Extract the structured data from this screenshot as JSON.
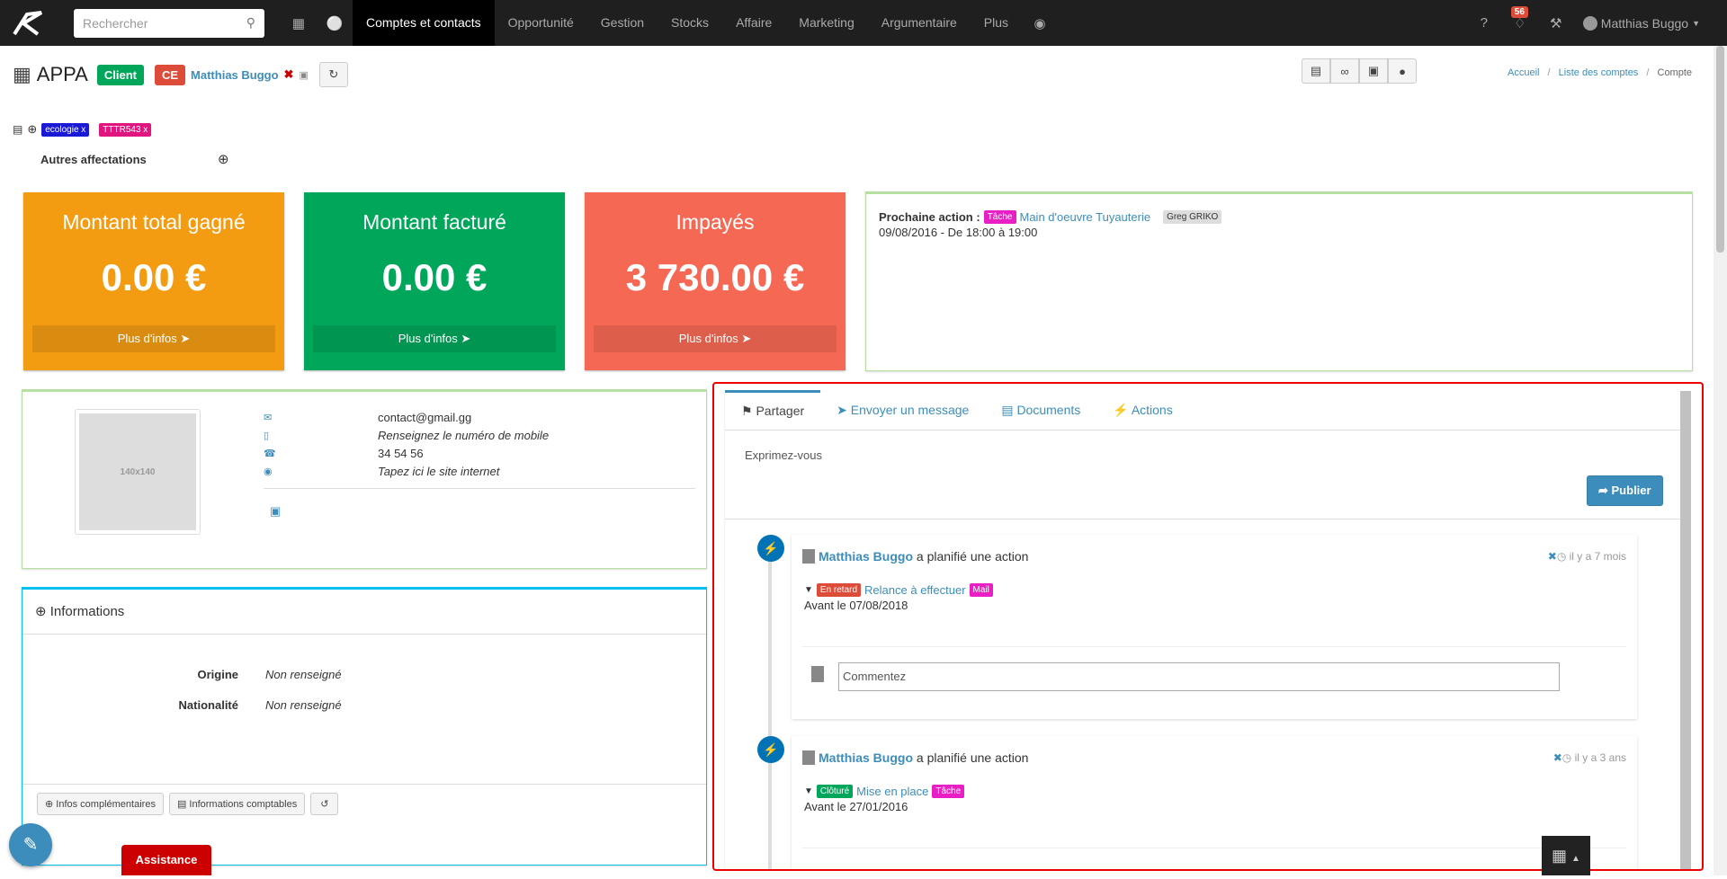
{
  "topbar": {
    "search_placeholder": "Rechercher",
    "nav": [
      "Comptes et contacts",
      "Opportunité",
      "Gestion",
      "Stocks",
      "Affaire",
      "Marketing",
      "Argumentaire",
      "Plus"
    ],
    "notif_count": "56",
    "user": "Matthias Buggo"
  },
  "header": {
    "account_name": "APPA",
    "client_label": "Client",
    "ce_label": "CE",
    "owner": "Matthias Buggo",
    "breadcrumb": [
      "Accueil",
      "Liste des comptes",
      "Compte"
    ]
  },
  "tags": [
    "ecologie x",
    "TTTR543 x"
  ],
  "autres_affectations": "Autres affectations",
  "kpis": [
    {
      "title": "Montant total gagné",
      "value": "0.00 €",
      "more": "Plus d'infos",
      "color": "#f39c12"
    },
    {
      "title": "Montant facturé",
      "value": "0.00 €",
      "more": "Plus d'infos",
      "color": "#00a65a"
    },
    {
      "title": "Impayés",
      "value": "3 730.00 €",
      "more": "Plus d'infos",
      "color": "#f56954"
    }
  ],
  "next_action": {
    "label": "Prochaine action :",
    "type": "Tâche",
    "title": "Main d'oeuvre Tuyauterie",
    "assignee": "Greg GRIKO",
    "date": "09/08/2016 - De 18:00 à 19:00"
  },
  "contact": {
    "avatar_text": "140x140",
    "email": "contact@gmail.gg",
    "mobile": "Renseignez le numéro de mobile",
    "phone": "34 54 56",
    "website": "Tapez ici le site internet"
  },
  "informations": {
    "title": "Informations",
    "rows": [
      {
        "label": "Origine",
        "value": "Non renseigné"
      },
      {
        "label": "Nationalité",
        "value": "Non renseigné"
      }
    ],
    "btn_infos": "Infos complémentaires",
    "btn_comptables": "Informations comptables"
  },
  "assistance": "Assistance",
  "feed": {
    "tabs": [
      "Partager",
      "Envoyer un message",
      "Documents",
      "Actions"
    ],
    "placeholder": "Exprimez-vous",
    "publish": "Publier",
    "comment_placeholder": "Commentez",
    "items": [
      {
        "user": "Matthias Buggo",
        "verb": "a planifié une action",
        "time": "il y a 7 mois",
        "status": "En retard",
        "status_color": "#dd4b39",
        "title": "Relance à effectuer",
        "type": "Mail",
        "due": "Avant le 07/08/2018"
      },
      {
        "user": "Matthias Buggo",
        "verb": "a planifié une action",
        "time": "il y a 3 ans",
        "status": "Clôturé",
        "status_color": "#00a65a",
        "title": "Mise en place",
        "type": "Tâche",
        "due": "Avant le 27/01/2016"
      }
    ]
  }
}
